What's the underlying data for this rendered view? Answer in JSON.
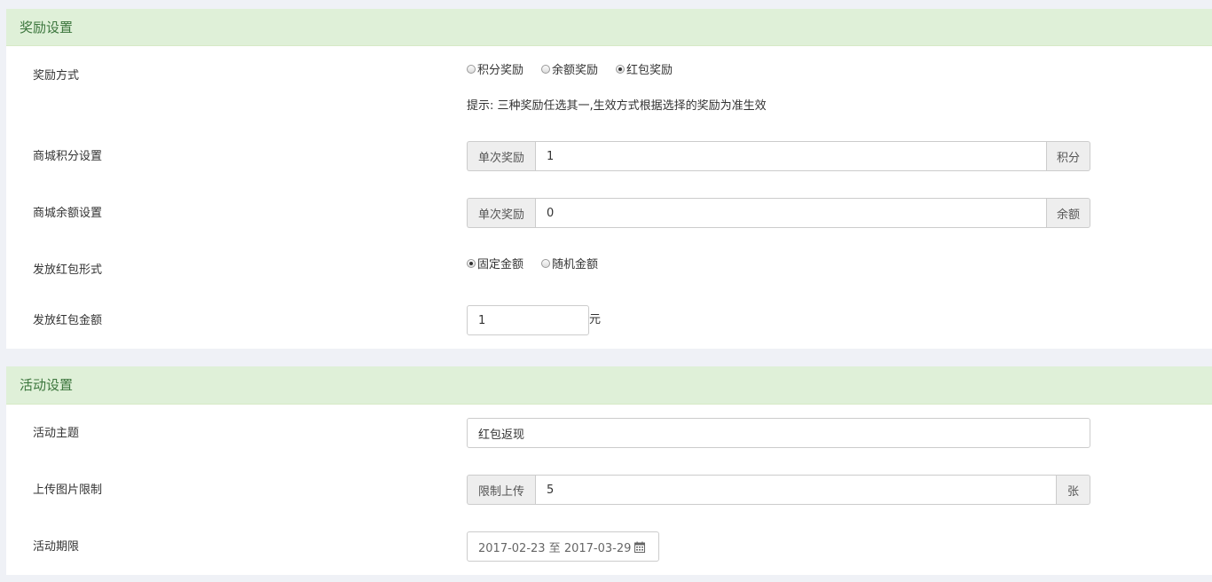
{
  "reward_section": {
    "title": "奖励设置",
    "reward_method": {
      "label": "奖励方式",
      "options": [
        {
          "label": "积分奖励",
          "checked": false
        },
        {
          "label": "余额奖励",
          "checked": false
        },
        {
          "label": "红包奖励",
          "checked": true
        }
      ],
      "hint": "提示: 三种奖励任选其一,生效方式根据选择的奖励为准生效"
    },
    "mall_points": {
      "label": "商城积分设置",
      "prefix": "单次奖励",
      "value": "1",
      "suffix": "积分"
    },
    "mall_balance": {
      "label": "商城余额设置",
      "prefix": "单次奖励",
      "value": "0",
      "suffix": "余额"
    },
    "redpacket_form": {
      "label": "发放红包形式",
      "options": [
        {
          "label": "固定金额",
          "checked": true
        },
        {
          "label": "随机金额",
          "checked": false
        }
      ]
    },
    "redpacket_amount": {
      "label": "发放红包金额",
      "value": "1",
      "unit": "元"
    }
  },
  "activity_section": {
    "title": "活动设置",
    "topic": {
      "label": "活动主题",
      "value": "红包返现"
    },
    "upload_limit": {
      "label": "上传图片限制",
      "prefix": "限制上传",
      "value": "5",
      "suffix": "张"
    },
    "period": {
      "label": "活动期限",
      "value": "2017-02-23 至 2017-03-29",
      "icon": "calendar-icon"
    }
  }
}
